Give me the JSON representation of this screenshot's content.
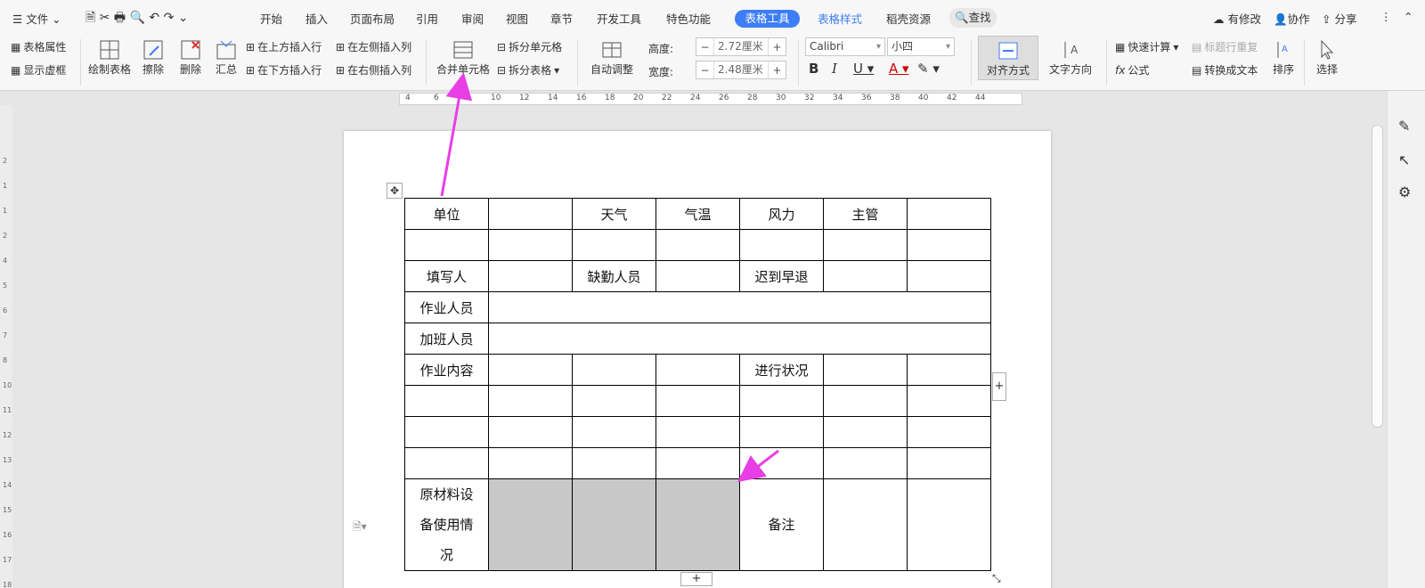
{
  "menu": {
    "file": "文件",
    "tabs": [
      "开始",
      "插入",
      "页面布局",
      "引用",
      "审阅",
      "视图",
      "章节",
      "开发工具",
      "特色功能"
    ],
    "active_tab": "表格工具",
    "style_tab": "表格样式",
    "resource_tab": "稻壳资源",
    "search": "查找",
    "modified": "有修改",
    "collab": "协作",
    "share": "分享"
  },
  "ribbon": {
    "table_props": "表格属性",
    "show_grid": "显示虚框",
    "draw_table": "绘制表格",
    "erase": "擦除",
    "delete": "删除",
    "summary": "汇总",
    "insert_above": "在上方插入行",
    "insert_below": "在下方插入行",
    "insert_left": "在左侧插入列",
    "insert_right": "在右侧插入列",
    "merge": "合并单元格",
    "split_cell": "拆分单元格",
    "split_table": "拆分表格",
    "autofit": "自动调整",
    "height_label": "高度:",
    "height_value": "2.72厘米",
    "width_label": "宽度:",
    "width_value": "2.48厘米",
    "font_name": "Calibri",
    "font_size": "小四",
    "align": "对齐方式",
    "text_dir": "文字方向",
    "quick_calc": "快速计算",
    "repeat_header": "标题行重复",
    "formula": "公式",
    "to_text": "转换成文本",
    "sort": "排序",
    "select": "选择"
  },
  "ruler_ticks": [
    "2",
    "4",
    "6",
    "8",
    "10",
    "12",
    "14",
    "16",
    "18",
    "20",
    "22",
    "24",
    "26",
    "28",
    "30",
    "32",
    "34",
    "36",
    "38",
    "40",
    "42",
    "44"
  ],
  "vruler_ticks": [
    "2",
    "1",
    "1",
    "2",
    "4",
    "5",
    "6",
    "7",
    "8",
    "10",
    "11",
    "12",
    "13",
    "14",
    "15",
    "16",
    "17",
    "18",
    "19"
  ],
  "table": {
    "r0": [
      "单位",
      "",
      "天气",
      "气温",
      "风力",
      "主管",
      ""
    ],
    "r2": [
      "填写人",
      "",
      "缺勤人员",
      "",
      "迟到早退",
      "",
      ""
    ],
    "r3": "作业人员",
    "r4": "加班人员",
    "r5": [
      "作业内容",
      "",
      "",
      "",
      "进行状况",
      "",
      ""
    ],
    "last_a": "原材料设",
    "last_b": "备使用情",
    "last_c": "况",
    "note": "备注"
  },
  "colors": {
    "accent": "#3d7ef5",
    "arrow": "#e83ee6",
    "merge_gray": "#c8c8c8"
  }
}
